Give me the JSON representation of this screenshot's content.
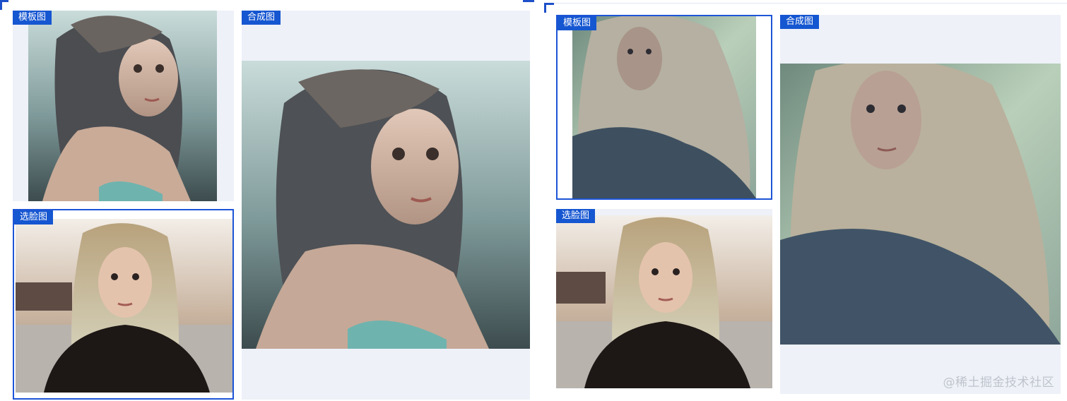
{
  "left": {
    "template_tag": "模板图",
    "face_tag": "选脸图",
    "result_tag": "合成图",
    "template_image": "dark-haired-woman-portrait",
    "face_image": "blonde-woman-black-tshirt-photo",
    "result_image": "merged-dark-haired-portrait"
  },
  "right": {
    "template_tag": "模板图",
    "face_tag": "选脸图",
    "result_tag": "合成图",
    "template_image": "pale-blonde-figure-painting",
    "face_image": "blonde-woman-black-tshirt-photo",
    "result_image": "merged-pale-blonde-painting"
  },
  "watermark": "@稀土掘金技术社区",
  "colors": {
    "accent": "#1556d1",
    "card_bg": "#eef1f8"
  }
}
